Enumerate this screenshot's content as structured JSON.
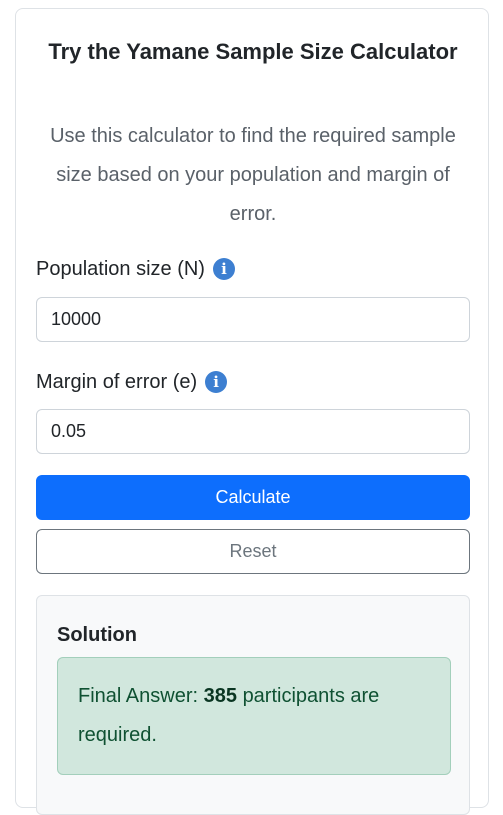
{
  "calculator": {
    "title": "Try the Yamane Sample Size Calculator",
    "description": "Use this calculator to find the required sample size based on your population and margin of error.",
    "population": {
      "label": "Population size (N)",
      "value": "10000",
      "info_icon": "info-icon"
    },
    "margin": {
      "label": "Margin of error (e)",
      "value": "0.05",
      "info_icon": "info-icon"
    },
    "calculate_label": "Calculate",
    "reset_label": "Reset"
  },
  "solution": {
    "heading": "Solution",
    "answer_prefix": "Final Answer:",
    "answer_value": "385",
    "answer_suffix": "participants are required."
  },
  "colors": {
    "primary": "#0d6efd",
    "success_bg": "#d1e7dd",
    "success_text": "#0f5132",
    "info_icon": "#3d7fd1"
  }
}
